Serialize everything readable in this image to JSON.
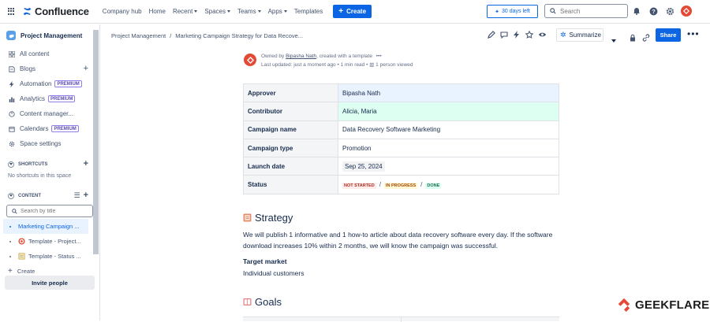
{
  "topbar": {
    "logo": "Confluence",
    "nav": [
      "Company hub",
      "Home",
      "Recent",
      "Spaces",
      "Teams",
      "Apps",
      "Templates"
    ],
    "create_label": "Create",
    "trial_label": "30 days left",
    "search_placeholder": "Search"
  },
  "sidebar": {
    "space_name": "Project Management",
    "items": [
      {
        "label": "All content",
        "icon": "all-content-icon"
      },
      {
        "label": "Blogs",
        "icon": "blog-icon"
      },
      {
        "label": "Automation",
        "icon": "lightning-icon",
        "badge": "PREMIUM"
      },
      {
        "label": "Analytics",
        "icon": "analytics-icon",
        "badge": "PREMIUM"
      },
      {
        "label": "Content manager...",
        "icon": "content-manager-icon"
      },
      {
        "label": "Calendars",
        "icon": "calendar-icon",
        "badge": "PREMIUM"
      },
      {
        "label": "Space settings",
        "icon": "gear-icon"
      }
    ],
    "shortcuts_label": "SHORTCUTS",
    "no_shortcuts": "No shortcuts in this space",
    "content_label": "CONTENT",
    "search_placeholder": "Search by title",
    "tree": [
      {
        "label": "Marketing Campaign ..."
      },
      {
        "label": "Template - Project..."
      },
      {
        "label": "Template - Status ..."
      }
    ],
    "create_label": "Create",
    "invite_label": "Invite people"
  },
  "page": {
    "breadcrumb": [
      "Project Management",
      "Marketing Campaign Strategy for Data Recove..."
    ],
    "summarize_label": "Summarize",
    "share_label": "Share",
    "owner_prefix": "Owned by",
    "owner_name": "Bipasha Nath",
    "owner_suffix": ", created with a template",
    "meta": "Last updated: just a moment ago",
    "read_time": "1 min read",
    "views": "1 person viewed",
    "props": [
      {
        "key": "Approver",
        "value": "Bipasha Nath"
      },
      {
        "key": "Contributor",
        "value": "Alicia, Maria"
      },
      {
        "key": "Campaign name",
        "value": "Data Recovery Software Marketing"
      },
      {
        "key": "Campaign type",
        "value": "Promotion"
      },
      {
        "key": "Launch date",
        "value": "Sep 25, 2024"
      },
      {
        "key": "Status",
        "statuses": [
          "NOT STARTED",
          "IN PROGRESS",
          "DONE"
        ]
      }
    ],
    "strategy_heading": "Strategy",
    "strategy_text": "We will publish 1 informative and 1 how-to article about data recovery software every day. If the software download increases 10% within 2 months, we will know the campaign was successful.",
    "target_heading": "Target market",
    "target_text": "Individual customers",
    "goals_heading": "Goals"
  },
  "watermark": "GEEKFLARE",
  "colors": {
    "primary": "#0c66e4",
    "brand_orange": "#e34935"
  }
}
